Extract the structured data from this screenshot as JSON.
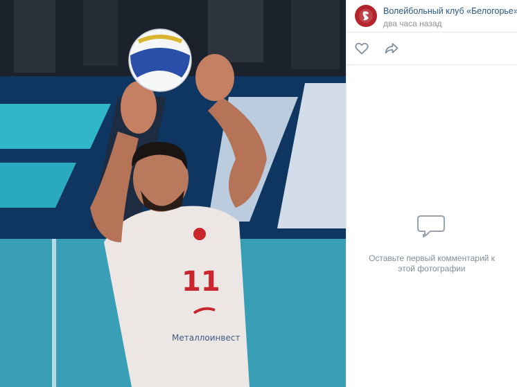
{
  "post": {
    "author": "Волейбольный клуб «Белогорье»",
    "time": "два часа назад"
  },
  "photo": {
    "jersey_number": "11",
    "sponsor_text": "Металлоинвест"
  },
  "actions": {
    "like_icon": "heart-icon",
    "share_icon": "share-arrow-icon"
  },
  "comments": {
    "empty_text": "Оставьте первый комментарий к этой фотографии",
    "empty_icon": "comment-bubbles-icon"
  },
  "colors": {
    "link": "#2a5885",
    "muted": "#939393",
    "avatar": "#b4242b",
    "icon": "#818c99"
  }
}
